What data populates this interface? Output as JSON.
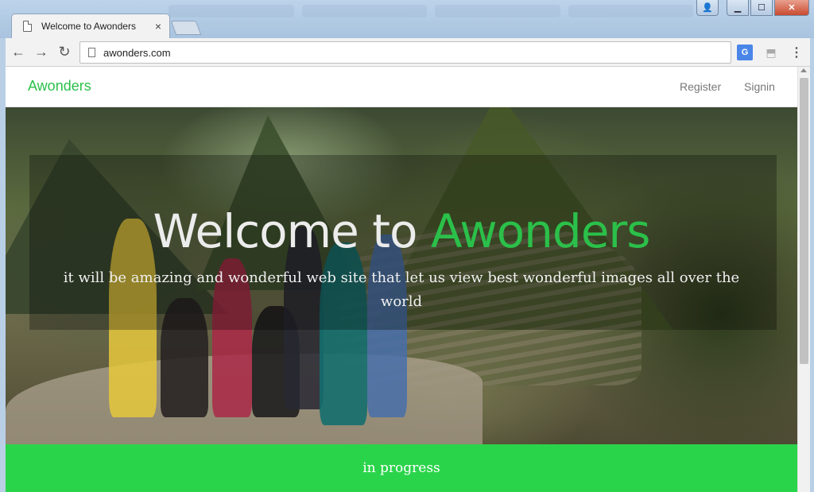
{
  "browser": {
    "tab_title": "Welcome to Awonders",
    "tab_close": "×",
    "address": "awonders.com",
    "controls": {
      "minimize": "▁",
      "maximize": "☐",
      "close": "✕",
      "user": "👤"
    },
    "nav": {
      "back": "←",
      "forward": "→",
      "reload": "↻"
    },
    "extensions": {
      "translate": "G",
      "pdf": "⬒",
      "menu": "⋮"
    }
  },
  "site": {
    "brand": "Awonders",
    "nav_links": {
      "register": "Register",
      "signin": "Signin"
    },
    "hero": {
      "title_prefix": "Welcome to ",
      "title_accent": "Awonders",
      "subtitle": "it will be amazing and wonderful web site that let us view best wonderful images all over the world"
    },
    "status_text": "in progress"
  },
  "colors": {
    "brand": "#2bc04a",
    "status_bar": "#2ad44a",
    "nav_link": "#777777"
  }
}
